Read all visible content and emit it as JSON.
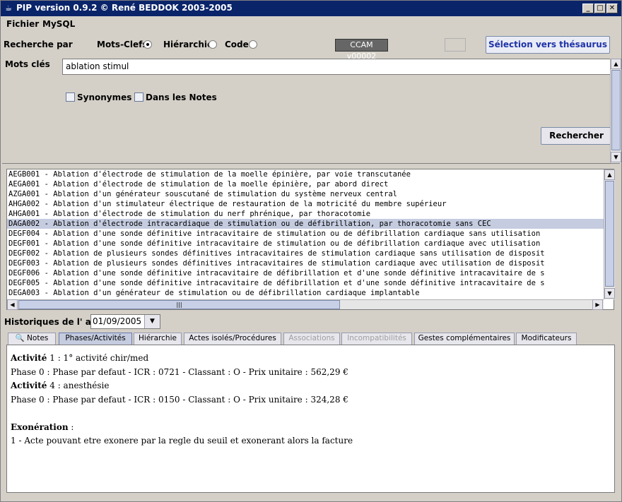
{
  "window": {
    "title": "PIP version 0.9.2 © René BEDDOK 2003-2005"
  },
  "menu": {
    "items": [
      "Fichier",
      "MySQL"
    ]
  },
  "search": {
    "label": "Recherche par",
    "options": [
      {
        "label": "Mots-Clefs",
        "checked": true
      },
      {
        "label": "Hiérarchie",
        "checked": false
      },
      {
        "label": "Code",
        "checked": false
      }
    ],
    "ccam_version": "CCAM v00002",
    "thesaurus_button": "Sélection vers thésaurus",
    "keywords_label": "Mots clés",
    "keywords_value": "ablation stimul",
    "checkbox_synonymes": "Synonymes",
    "checkbox_notes": "Dans les Notes",
    "search_button": "Rechercher"
  },
  "results": {
    "selected_index": 5,
    "rows": [
      "AEGB001 - Ablation d'électrode de stimulation de la moelle épinière, par voie transcutanée",
      "AEGA001 - Ablation d'électrode de stimulation de la moelle épinière, par abord direct",
      "AZGA001 - Ablation d'un générateur souscutané de stimulation du système nerveux central",
      "AHGA002 - Ablation d'un stimulateur électrique de restauration de la motricité du membre supérieur",
      "AHGA001 - Ablation d'électrode de stimulation du nerf phrénique, par thoracotomie",
      "DAGA002 - Ablation d'électrode intracardiaque de stimulation ou de défibrillation, par thoracotomie sans CEC",
      "DEGF004 - Ablation d'une sonde définitive intracavitaire de stimulation ou de défibrillation cardiaque sans utilisation",
      "DEGF001 - Ablation d'une sonde définitive intracavitaire de stimulation ou de défibrillation cardiaque avec utilisation",
      "DEGF002 - Ablation de plusieurs sondes définitives intracavitaires de stimulation cardiaque sans utilisation de disposit",
      "DEGF003 - Ablation de plusieurs sondes définitives intracavitaires de stimulation cardiaque avec utilisation de disposit",
      "DEGF006 - Ablation d'une sonde définitive intracavitaire de défibrillation et d'une sonde définitive intracavitaire de s",
      "DEGF005 - Ablation d'une sonde définitive intracavitaire de défibrillation et d'une sonde définitive intracavitaire de s",
      "DEGA003 - Ablation d'un générateur de stimulation ou de défibrillation cardiaque implantable"
    ]
  },
  "history": {
    "label": "Historiques de l' acte",
    "date": "01/09/2005"
  },
  "tabs": [
    {
      "label": "Notes",
      "active": false,
      "disabled": false
    },
    {
      "label": "Phases/Activités",
      "active": true,
      "disabled": false
    },
    {
      "label": "Hiérarchie",
      "active": false,
      "disabled": false
    },
    {
      "label": "Actes isolés/Procédures",
      "active": false,
      "disabled": false
    },
    {
      "label": "Associations",
      "active": false,
      "disabled": true
    },
    {
      "label": "Incompatibilités",
      "active": false,
      "disabled": true
    },
    {
      "label": "Gestes complémentaires",
      "active": false,
      "disabled": false
    },
    {
      "label": "Modificateurs",
      "active": false,
      "disabled": false
    }
  ],
  "details": {
    "activity1_label": "Activité",
    "activity1_value": " 1 : 1° activité chir/med",
    "phase1": "Phase 0 : Phase par defaut - ICR : 0721 - Classant : O - Prix unitaire : 562,29 €",
    "activity2_label": "Activité",
    "activity2_value": " 4 : anesthésie",
    "phase2": "Phase 0 : Phase par defaut - ICR : 0150 - Classant : O - Prix unitaire : 324,28 €",
    "exoneration_label": "Exonération",
    "exoneration_sep": " :",
    "exoneration_text": "1 - Acte pouvant etre exonere par la regle du seuil et exonerant alors la facture"
  },
  "icons": [
    "java-cup-icon",
    "minimize-icon",
    "maximize-icon",
    "close-icon",
    "magnifier-icon",
    "scroll-up-icon",
    "scroll-down-icon",
    "scroll-left-icon",
    "scroll-right-icon",
    "chevron-down-icon"
  ],
  "colors": {
    "titlebar": "#0a246a",
    "selection": "#c5cce0",
    "thesaurus_text": "#1f33a8",
    "ccam_badge": "#666666"
  }
}
